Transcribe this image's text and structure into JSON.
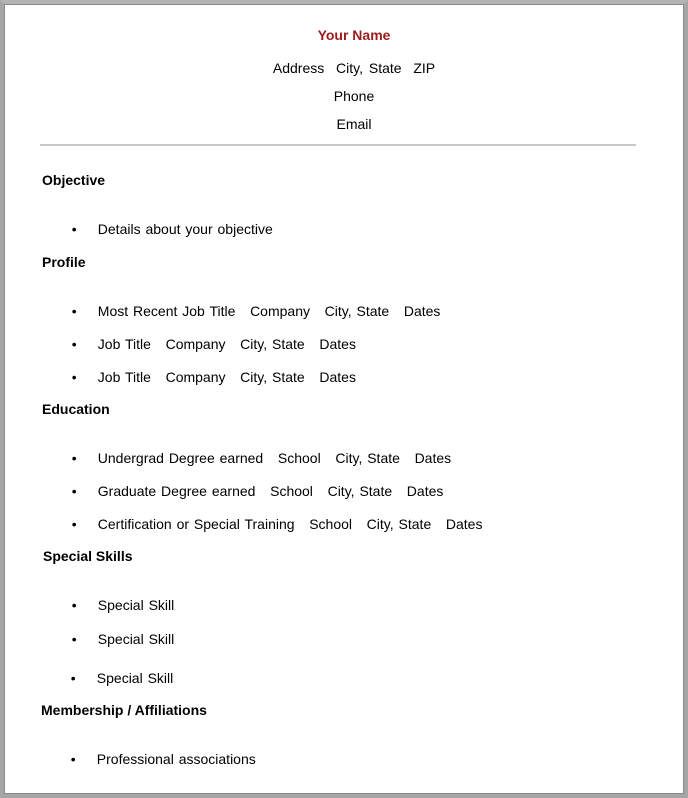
{
  "header": {
    "name": "Your Name",
    "address": "Address  City, State  ZIP",
    "phone": "Phone",
    "email": "Email"
  },
  "colors": {
    "name": "#9b1c1c",
    "rule": "#c8c8c8",
    "frame": "#a6a6a6"
  },
  "sections": {
    "objective": {
      "title": "Objective",
      "items": [
        "Details about your objective"
      ]
    },
    "profile": {
      "title": "Profile",
      "items": [
        "Most Recent Job Title   Company   City, State   Dates",
        "Job Title   Company   City, State   Dates",
        "Job Title   Company   City, State   Dates"
      ]
    },
    "education": {
      "title": "Education",
      "items": [
        "Undergrad Degree earned   School   City, State   Dates",
        "Graduate Degree earned   School   City, State   Dates",
        "Certification or Special Training   School   City, State   Dates"
      ]
    },
    "skills": {
      "title": "Special Skills",
      "items": [
        "Special Skill",
        "Special Skill",
        "Special Skill"
      ]
    },
    "membership": {
      "title": "Membership / Affiliations",
      "items": [
        "Professional associations"
      ]
    }
  },
  "bullet_glyph": "•"
}
